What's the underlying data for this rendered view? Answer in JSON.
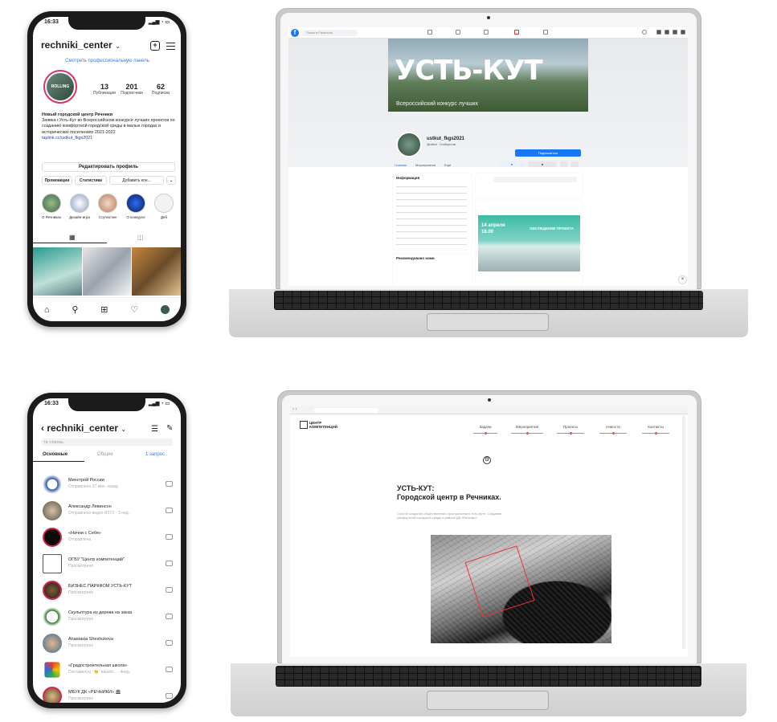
{
  "phone1": {
    "time": "16:33",
    "username": "rechniki_center",
    "pro_link": "Смотреть профессиональную панель",
    "stats": [
      {
        "value": "13",
        "label": "Публикации"
      },
      {
        "value": "201",
        "label": "Подписчики"
      },
      {
        "value": "62",
        "label": "Подписки"
      }
    ],
    "bio_title": "Новый городской центр Речники",
    "bio_text": "Заявка г.Усть-Кут во Всероссийском конкурсе лучших проектов по созданию комфортной городской среды в малых городах и исторических поселениях 2021-2022",
    "bio_link": "taplink.cc/ustkut_fkgs2021",
    "edit_profile": "Редактировать профиль",
    "btn_promo": "Промоакции",
    "btn_stats": "Статистика",
    "btn_add": "Добавить кон...",
    "highlights": [
      "О Речниках",
      "Дизайн-игра",
      "Соучастие",
      "О конкурсе",
      "Деб"
    ]
  },
  "phone2": {
    "time": "16:33",
    "username": "rechniki_center",
    "subline": "ТВ 7/ЗВЯЗЬ",
    "tab_main": "Основные",
    "tab_general": "Общие",
    "tab_requests": "1 запрос",
    "messages": [
      {
        "name": "Минстрой России",
        "sub": "Отправлено 37 мин. назад"
      },
      {
        "name": "Александр Левинсон",
        "sub": "Отправлено видео ИЗТУ · 3 нед."
      },
      {
        "name": "«Начни с Себя»",
        "sub": "Отправлено"
      },
      {
        "name": "ОГБУ \"Центр компетенций\"",
        "sub": "Просмотрено"
      },
      {
        "name": "БИЗНЕС ПАРКФОМ УСТЬ-КУТ",
        "sub": "Просмотрено"
      },
      {
        "name": "Скульптура из дерева на заказ",
        "sub": "Просмотрено"
      },
      {
        "name": "Anastasia Sheshukova",
        "sub": "Просмотрено"
      },
      {
        "name": "«Градостроительная школа»",
        "sub": "Поставил(а) \"👏\" вашей... · 4нед."
      },
      {
        "name": "МБУК ДК «РЕЧНИКИ» 🏛",
        "sub": "Просмотрено"
      }
    ]
  },
  "laptop1": {
    "search_placeholder": "Поиск в Facebook",
    "cover_title": "УСТЬ-КУТ",
    "cover_sub": "Всероссийский конкурс лучших",
    "page_name": "ustkut_fkgs2021",
    "page_sub": "@ustkut · Сообщество",
    "follow_btn": "Подписаться",
    "tabs": [
      "Главная",
      "Мероприятия",
      "Ещё"
    ],
    "info_title": "Информация",
    "recommend_title": "Рекомендовано нами",
    "post_date": "14 апреля",
    "post_time": "18.00",
    "post_text": "ОБСУЖДЕНИЕ ПРОЕКТА"
  },
  "laptop2": {
    "logo_line1": "ЦЕНТР",
    "logo_line2": "КОМПЕТЕНЦИЙ",
    "nav": [
      "Задачи",
      "Мероприятия",
      "Проекты",
      "Новости",
      "Контакты"
    ],
    "heading_line1": "УСТЬ-КУТ:",
    "heading_line2": "Городской центр в Речниках.",
    "intro": "Способ создания общественного пространства в Усть-Куте. Создание комфортной городской среды в районе ДК «Речники»."
  }
}
